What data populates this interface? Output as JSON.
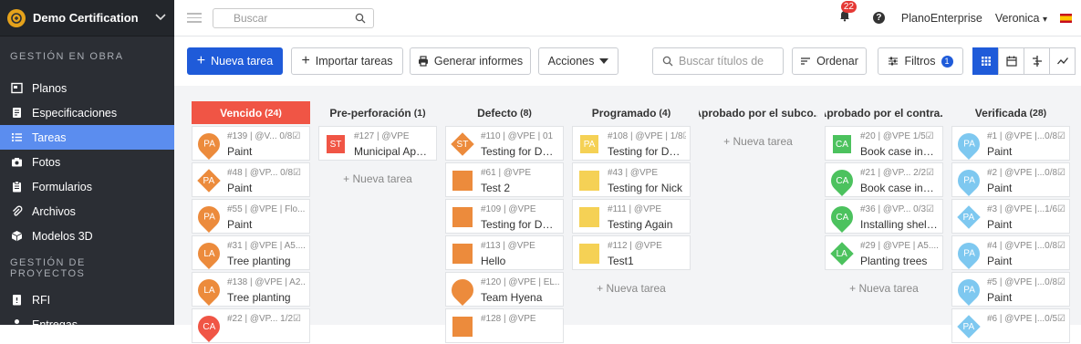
{
  "sidebar": {
    "project_name": "Demo Certification",
    "section1": "GESTIÓN EN OBRA",
    "items1": [
      {
        "label": "Planos",
        "icon": "plans-icon"
      },
      {
        "label": "Especificaciones",
        "icon": "specs-icon"
      },
      {
        "label": "Tareas",
        "icon": "tasks-icon"
      },
      {
        "label": "Fotos",
        "icon": "camera-icon"
      },
      {
        "label": "Formularios",
        "icon": "forms-icon"
      },
      {
        "label": "Archivos",
        "icon": "paperclip-icon"
      },
      {
        "label": "Modelos 3D",
        "icon": "cube-icon"
      }
    ],
    "section2": "GESTIÓN DE PROYECTOS",
    "items2": [
      {
        "label": "RFI",
        "icon": "rfi-icon"
      },
      {
        "label": "Entregas",
        "icon": "person-icon"
      }
    ]
  },
  "topbar": {
    "search_placeholder": "Buscar",
    "notifications_count": "22",
    "help": "?",
    "company": "PlanoEnterprise",
    "user": "Veronica",
    "user_caret": "▾"
  },
  "toolbar": {
    "new_task": "Nueva tarea",
    "import_tasks": "Importar tareas",
    "generate_reports": "Generar informes",
    "actions": "Acciones",
    "search_titles_placeholder": "Buscar títulos de",
    "sort": "Ordenar",
    "filters": "Filtros",
    "filters_count": "1"
  },
  "colors": {
    "red": "#f05545",
    "orange": "#ec8b3c",
    "yellow": "#f5d155",
    "green": "#4cc25e",
    "lightblue": "#7ec8f0",
    "primary": "#1f5bd9"
  },
  "board": {
    "add_task_label": "+ Nueva tarea",
    "columns": [
      {
        "title": "Vencido",
        "count": "(24)",
        "cards": [
          {
            "abbr": "PA",
            "shape": "pin",
            "color": "orange",
            "meta": "#139 | @V...  0/8☑",
            "title": "Paint"
          },
          {
            "abbr": "PA",
            "shape": "dia",
            "color": "orange",
            "meta": "#48 | @VP...  0/8☑",
            "title": "Paint"
          },
          {
            "abbr": "PA",
            "shape": "pin",
            "color": "orange",
            "meta": "#55 | @VPE | Flo...",
            "title": "Paint"
          },
          {
            "abbr": "LA",
            "shape": "pin",
            "color": "orange",
            "meta": "#31 | @VPE | A5....",
            "title": "Tree planting"
          },
          {
            "abbr": "LA",
            "shape": "pin",
            "color": "orange",
            "meta": "#138 | @VPE | A2...",
            "title": "Tree planting"
          },
          {
            "abbr": "CA",
            "shape": "pin",
            "color": "red",
            "meta": "#22 | @VP...  1/2☑",
            "title": ""
          }
        ]
      },
      {
        "title": "Pre-perforación",
        "count": "(1)",
        "cards": [
          {
            "abbr": "ST",
            "shape": "sqsm",
            "color": "red",
            "meta": "#127 | @VPE",
            "title": "Municipal Appr..."
          }
        ]
      },
      {
        "title": "Defecto",
        "count": "(8)",
        "cards": [
          {
            "abbr": "ST",
            "shape": "dia",
            "color": "orange",
            "meta": "#110 | @VPE | 01",
            "title": "Testing for Der..."
          },
          {
            "abbr": "",
            "shape": "sq",
            "color": "orange",
            "meta": "#61 | @VPE",
            "title": "Test 2"
          },
          {
            "abbr": "",
            "shape": "sq",
            "color": "orange",
            "meta": "#109 | @VPE",
            "title": "Testing for Der..."
          },
          {
            "abbr": "",
            "shape": "sq",
            "color": "orange",
            "meta": "#113 | @VPE",
            "title": "Hello"
          },
          {
            "abbr": "",
            "shape": "pin",
            "color": "orange",
            "meta": "#120 | @VPE | EL...",
            "title": "Team Hyena"
          },
          {
            "abbr": "",
            "shape": "sq",
            "color": "orange",
            "meta": "#128 | @VPE",
            "title": ""
          }
        ]
      },
      {
        "title": "Programado",
        "count": "(4)",
        "cards": [
          {
            "abbr": "PA",
            "shape": "sqsm",
            "color": "yellow",
            "meta": "#108 | @VPE | 1/8☑",
            "title": "Testing for Derek"
          },
          {
            "abbr": "",
            "shape": "sq",
            "color": "yellow",
            "meta": "#43 | @VPE",
            "title": "Testing for Nick"
          },
          {
            "abbr": "",
            "shape": "sq",
            "color": "yellow",
            "meta": "#111 | @VPE",
            "title": "Testing Again"
          },
          {
            "abbr": "",
            "shape": "sq",
            "color": "yellow",
            "meta": "#112 | @VPE",
            "title": "Test1"
          }
        ]
      },
      {
        "title": "Aprobado por el subco...",
        "count": "",
        "cards": []
      },
      {
        "title": "Aprobado por el contra...",
        "count": "",
        "cards": [
          {
            "abbr": "CA",
            "shape": "sqsm",
            "color": "green",
            "meta": "#20 | @VPE  1/5☑",
            "title": "Book case insta..."
          },
          {
            "abbr": "CA",
            "shape": "pin",
            "color": "green",
            "meta": "#21 | @VP...  2/2☑",
            "title": "Book case insta..."
          },
          {
            "abbr": "CA",
            "shape": "pin",
            "color": "green",
            "meta": "#36 | @VP...  0/3☑",
            "title": "Installing shelvi..."
          },
          {
            "abbr": "LA",
            "shape": "dia",
            "color": "green",
            "meta": "#29 | @VPE | A5....",
            "title": "Planting trees"
          }
        ]
      },
      {
        "title": "Verificada",
        "count": "(28)",
        "cards": [
          {
            "abbr": "PA",
            "shape": "pin",
            "color": "lightblue",
            "meta": "#1 | @VPE |...0/8☑",
            "title": "Paint"
          },
          {
            "abbr": "PA",
            "shape": "pin",
            "color": "lightblue",
            "meta": "#2 | @VPE |...0/8☑",
            "title": "Paint"
          },
          {
            "abbr": "PA",
            "shape": "dia",
            "color": "lightblue",
            "meta": "#3 | @VPE |...1/6☑",
            "title": "Paint"
          },
          {
            "abbr": "PA",
            "shape": "pin",
            "color": "lightblue",
            "meta": "#4 | @VPE |...0/8☑",
            "title": "Paint"
          },
          {
            "abbr": "PA",
            "shape": "pin",
            "color": "lightblue",
            "meta": "#5 | @VPE |...0/8☑",
            "title": "Paint"
          },
          {
            "abbr": "PA",
            "shape": "dia",
            "color": "lightblue",
            "meta": "#6 | @VPE |...0/5☑",
            "title": ""
          }
        ]
      }
    ]
  }
}
